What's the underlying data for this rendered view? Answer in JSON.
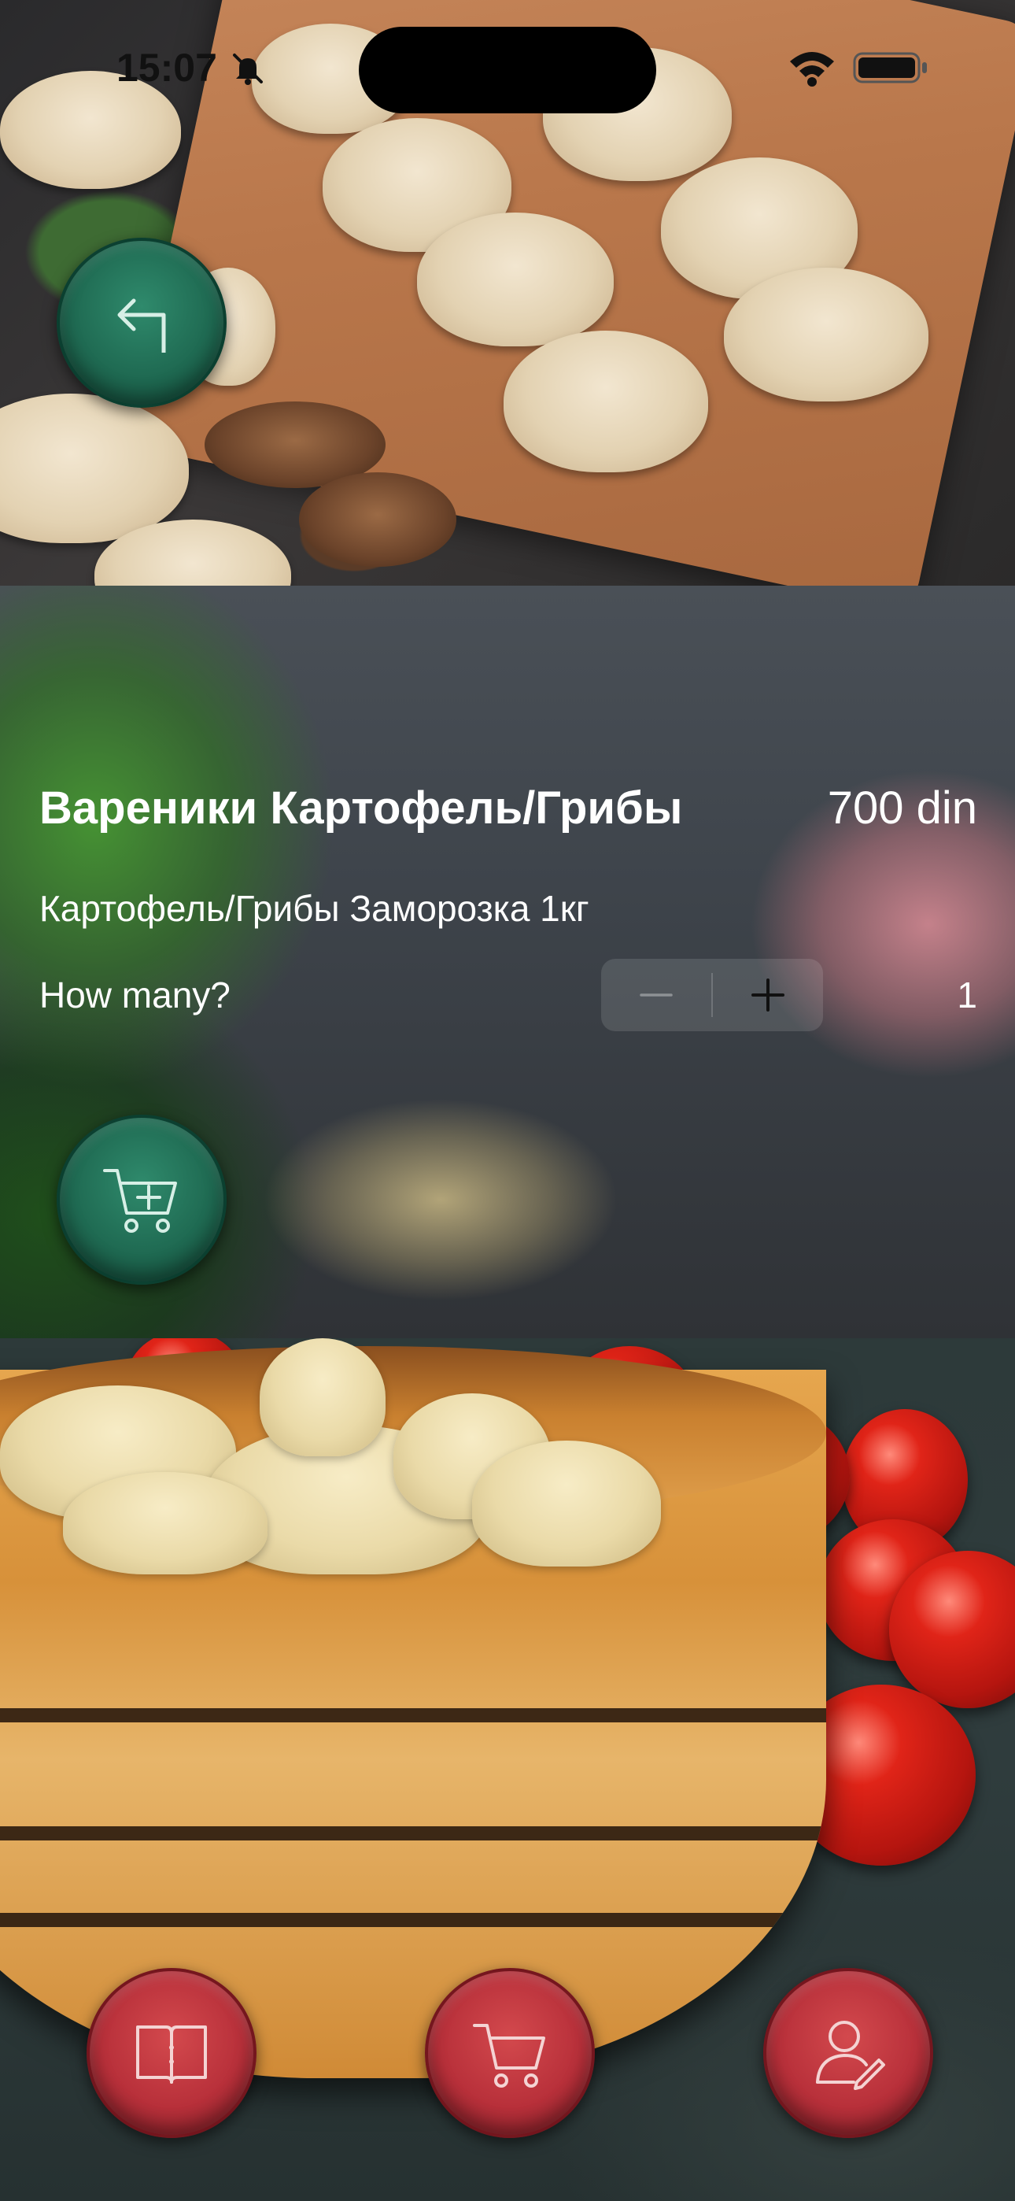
{
  "status_bar": {
    "time": "15:07",
    "icons": [
      "bell-slash-icon",
      "wifi-icon",
      "battery-icon"
    ]
  },
  "product": {
    "title": "Вареники Картофель/Грибы",
    "price": "700 din",
    "description": "Картофель/Грибы Заморозка 1кг",
    "quantity_label": "How many?",
    "quantity": "1"
  },
  "actions": {
    "back_icon": "back-arrow-icon",
    "add_to_cart_icon": "cart-plus-icon"
  },
  "tab_bar": {
    "items": [
      {
        "icon": "menu-book-icon"
      },
      {
        "icon": "cart-icon"
      },
      {
        "icon": "profile-icon"
      }
    ]
  },
  "colors": {
    "accent_green": "#1f6a52",
    "accent_red": "#b8303a",
    "text": "#ffffff"
  }
}
